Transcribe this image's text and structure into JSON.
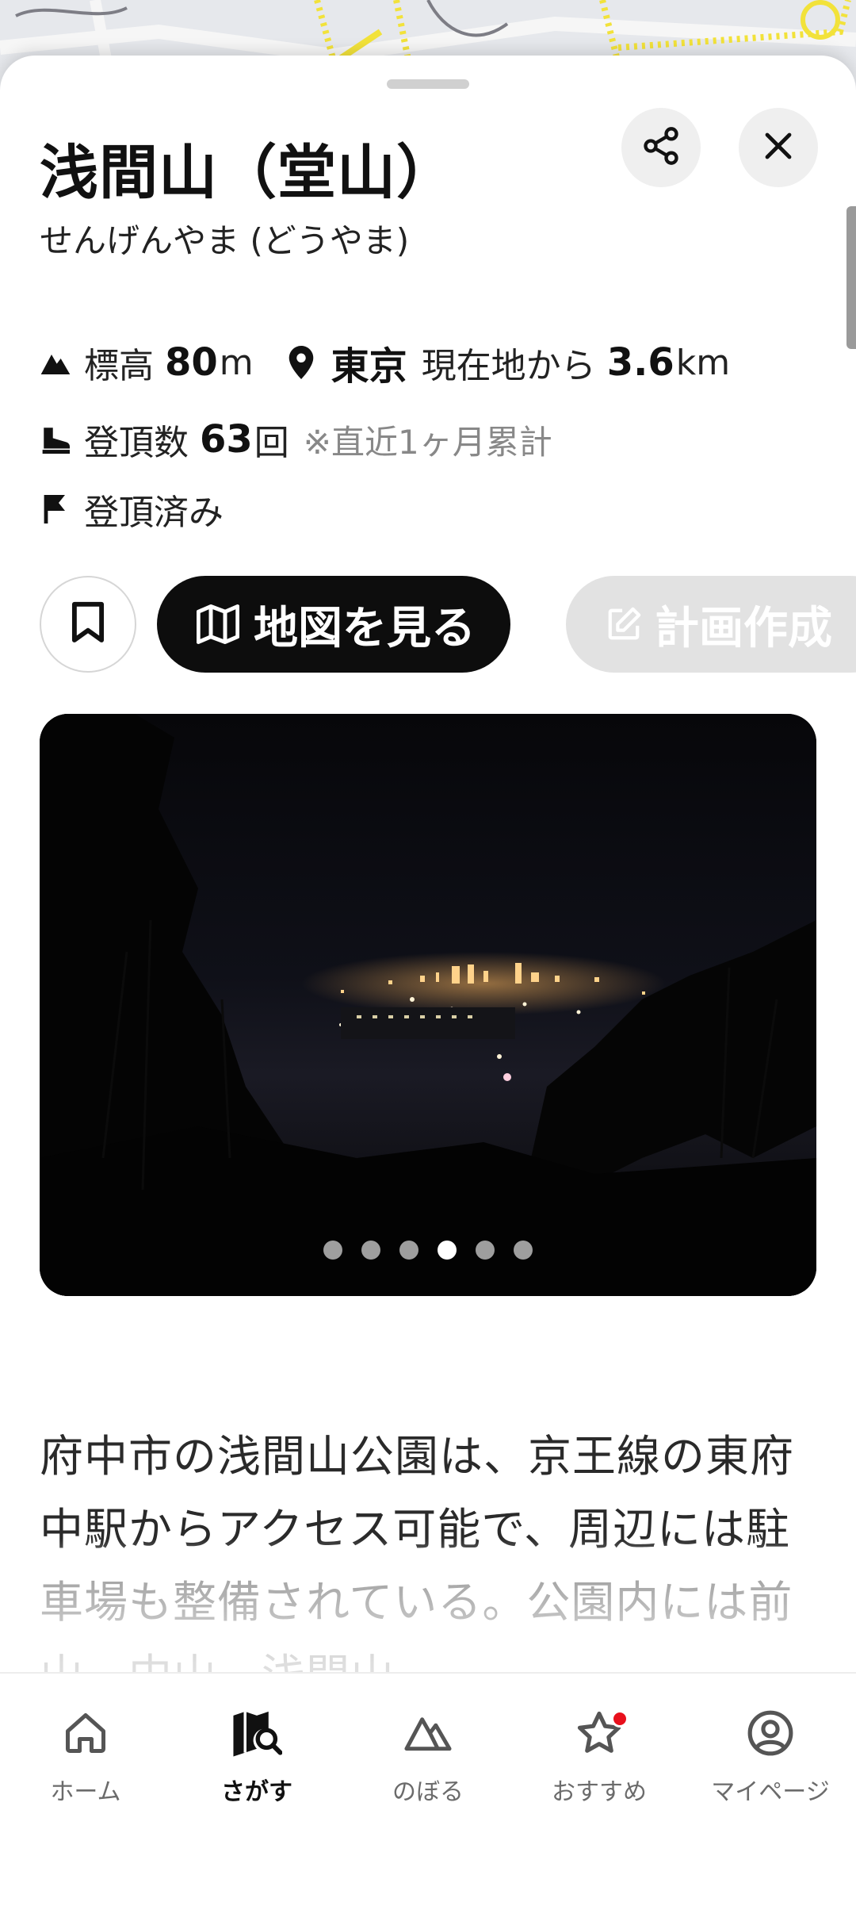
{
  "mountain": {
    "name": "浅間山（堂山）",
    "reading": "せんげんやま (どうやま)",
    "elevation_label": "標高",
    "elevation_value": "80",
    "elevation_unit": "m",
    "prefecture": "東京",
    "distance_label": "現在地から",
    "distance_value": "3.6",
    "distance_unit": "km",
    "summit_count_label": "登頂数",
    "summit_count_value": "63",
    "summit_count_unit": "回",
    "summit_count_note": "※直近1ヶ月累計",
    "status": "登頂済み"
  },
  "actions": {
    "view_map": "地図を見る",
    "create_plan": "計画作成"
  },
  "photo_carousel": {
    "total": 6,
    "active_index": 3
  },
  "description": "府中市の浅間山公園は、京王線の東府中駅からアクセス可能で、周辺には駐車場も整備されている。公園内には前山、中山、浅間山…",
  "tabs": [
    {
      "label": "ホーム",
      "icon": "home-icon"
    },
    {
      "label": "さがす",
      "icon": "map-search-icon"
    },
    {
      "label": "のぼる",
      "icon": "mountain-icon"
    },
    {
      "label": "おすすめ",
      "icon": "star-icon"
    },
    {
      "label": "マイページ",
      "icon": "user-icon"
    }
  ],
  "active_tab": "さがす",
  "colors": {
    "primary_button": "#0d0d0d",
    "disabled_button": "#e2e2e2",
    "notification_badge": "#e8101c",
    "map_route": "#f2e23a"
  }
}
